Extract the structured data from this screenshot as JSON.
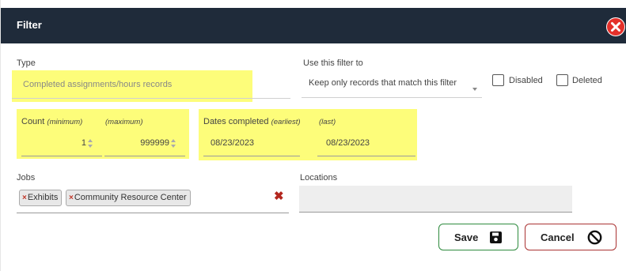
{
  "dialog": {
    "title": "Filter"
  },
  "type": {
    "label": "Type",
    "value": "Completed assignments/hours records"
  },
  "use_filter": {
    "label": "Use this filter to",
    "selected": "Keep only records that match this filter"
  },
  "checkboxes": {
    "disabled_label": "Disabled",
    "disabled_checked": false,
    "deleted_label": "Deleted",
    "deleted_checked": false
  },
  "count": {
    "label": "Count",
    "min_label": "(minimum)",
    "max_label": "(maximum)",
    "min_value": "1",
    "max_value": "999999"
  },
  "dates": {
    "label": "Dates completed",
    "earliest_label": "(earliest)",
    "last_label": "(last)",
    "earliest_value": "08/23/2023",
    "last_value": "08/23/2023"
  },
  "jobs": {
    "label": "Jobs",
    "tags": [
      "Exhibits",
      "Community Resource Center"
    ],
    "tag_remove_glyph": "×",
    "clear_glyph": "✖"
  },
  "locations": {
    "label": "Locations"
  },
  "buttons": {
    "save_label": "Save",
    "cancel_label": "Cancel"
  },
  "colors": {
    "titlebar": "#1f2b3a",
    "highlight": "#fdfd7a",
    "close_red": "#e4302a",
    "save_border": "#2e8b3e",
    "cancel_border": "#aa3333"
  }
}
